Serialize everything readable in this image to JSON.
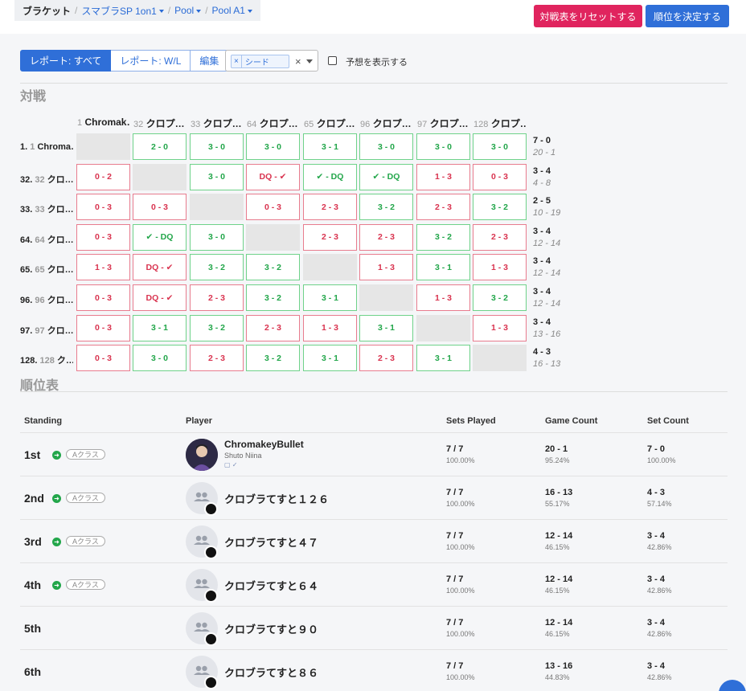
{
  "breadcrumb": {
    "home": "ブラケット",
    "items": [
      "スマブラSP 1on1",
      "Pool",
      "Pool A1"
    ]
  },
  "actions": {
    "reset": "対戦表をリセットする",
    "finalize": "順位を決定する"
  },
  "toolbar": {
    "report_all": "レポート: すべて",
    "report_wl": "レポート: W/L",
    "edit": "編集",
    "chip_remove": "×",
    "chip": "シード",
    "clear": "×",
    "show_prediction": "予想を表示する"
  },
  "matrix": {
    "title": "対戦",
    "columns": [
      {
        "seed": "1",
        "name": "Chromak…"
      },
      {
        "seed": "32",
        "name": "クロプ…"
      },
      {
        "seed": "33",
        "name": "クロプ…"
      },
      {
        "seed": "64",
        "name": "クロプ…"
      },
      {
        "seed": "65",
        "name": "クロプ…"
      },
      {
        "seed": "96",
        "name": "クロプ…"
      },
      {
        "seed": "97",
        "name": "クロプ…"
      },
      {
        "seed": "128",
        "name": "クロプ…"
      }
    ],
    "rows": [
      {
        "rank": "1.",
        "seed": "1",
        "name": "Chroma…",
        "cells": [
          [
            "self",
            ""
          ],
          [
            "win",
            "2 - 0"
          ],
          [
            "win",
            "3 - 0"
          ],
          [
            "win",
            "3 - 0"
          ],
          [
            "win",
            "3 - 1"
          ],
          [
            "win",
            "3 - 0"
          ],
          [
            "win",
            "3 - 0"
          ],
          [
            "win",
            "3 - 0"
          ]
        ],
        "sets": "7 - 0",
        "games": "20 - 1"
      },
      {
        "rank": "32.",
        "seed": "32",
        "name": "クロ…",
        "cells": [
          [
            "loss",
            "0 - 2"
          ],
          [
            "self",
            ""
          ],
          [
            "win",
            "3 - 0"
          ],
          [
            "loss",
            "DQ - ✔"
          ],
          [
            "win",
            "✔ - DQ"
          ],
          [
            "win",
            "✔ - DQ"
          ],
          [
            "loss",
            "1 - 3"
          ],
          [
            "loss",
            "0 - 3"
          ]
        ],
        "sets": "3 - 4",
        "games": "4 - 8"
      },
      {
        "rank": "33.",
        "seed": "33",
        "name": "クロ…",
        "cells": [
          [
            "loss",
            "0 - 3"
          ],
          [
            "loss",
            "0 - 3"
          ],
          [
            "self",
            ""
          ],
          [
            "loss",
            "0 - 3"
          ],
          [
            "loss",
            "2 - 3"
          ],
          [
            "win",
            "3 - 2"
          ],
          [
            "loss",
            "2 - 3"
          ],
          [
            "win",
            "3 - 2"
          ]
        ],
        "sets": "2 - 5",
        "games": "10 - 19"
      },
      {
        "rank": "64.",
        "seed": "64",
        "name": "クロ…",
        "cells": [
          [
            "loss",
            "0 - 3"
          ],
          [
            "win",
            "✔ - DQ"
          ],
          [
            "win",
            "3 - 0"
          ],
          [
            "self",
            ""
          ],
          [
            "loss",
            "2 - 3"
          ],
          [
            "loss",
            "2 - 3"
          ],
          [
            "win",
            "3 - 2"
          ],
          [
            "loss",
            "2 - 3"
          ]
        ],
        "sets": "3 - 4",
        "games": "12 - 14"
      },
      {
        "rank": "65.",
        "seed": "65",
        "name": "クロ…",
        "cells": [
          [
            "loss",
            "1 - 3"
          ],
          [
            "loss",
            "DQ - ✔"
          ],
          [
            "win",
            "3 - 2"
          ],
          [
            "win",
            "3 - 2"
          ],
          [
            "self",
            ""
          ],
          [
            "loss",
            "1 - 3"
          ],
          [
            "win",
            "3 - 1"
          ],
          [
            "loss",
            "1 - 3"
          ]
        ],
        "sets": "3 - 4",
        "games": "12 - 14"
      },
      {
        "rank": "96.",
        "seed": "96",
        "name": "クロ…",
        "cells": [
          [
            "loss",
            "0 - 3"
          ],
          [
            "loss",
            "DQ - ✔"
          ],
          [
            "loss",
            "2 - 3"
          ],
          [
            "win",
            "3 - 2"
          ],
          [
            "win",
            "3 - 1"
          ],
          [
            "self",
            ""
          ],
          [
            "loss",
            "1 - 3"
          ],
          [
            "win",
            "3 - 2"
          ]
        ],
        "sets": "3 - 4",
        "games": "12 - 14"
      },
      {
        "rank": "97.",
        "seed": "97",
        "name": "クロ…",
        "cells": [
          [
            "loss",
            "0 - 3"
          ],
          [
            "win",
            "3 - 1"
          ],
          [
            "win",
            "3 - 2"
          ],
          [
            "loss",
            "2 - 3"
          ],
          [
            "loss",
            "1 - 3"
          ],
          [
            "win",
            "3 - 1"
          ],
          [
            "self",
            ""
          ],
          [
            "loss",
            "1 - 3"
          ]
        ],
        "sets": "3 - 4",
        "games": "13 - 16"
      },
      {
        "rank": "128.",
        "seed": "128",
        "name": "ク…",
        "cells": [
          [
            "loss",
            "0 - 3"
          ],
          [
            "win",
            "3 - 0"
          ],
          [
            "loss",
            "2 - 3"
          ],
          [
            "win",
            "3 - 2"
          ],
          [
            "win",
            "3 - 1"
          ],
          [
            "loss",
            "2 - 3"
          ],
          [
            "win",
            "3 - 1"
          ],
          [
            "self",
            ""
          ]
        ],
        "sets": "4 - 3",
        "games": "16 - 13"
      }
    ]
  },
  "standings": {
    "title": "順位表",
    "headers": {
      "standing": "Standing",
      "player": "Player",
      "sets_played": "Sets Played",
      "game_count": "Game Count",
      "set_count": "Set Count"
    },
    "rows": [
      {
        "rank": "1st",
        "badge": "Aクラス",
        "name": "ChromakeyBullet",
        "sub": "Shuto Niina",
        "social": "▢ ✓",
        "sets_played": "7 / 7",
        "sets_played_pct": "100.00%",
        "games": "20 - 1",
        "games_pct": "95.24%",
        "sets": "7 - 0",
        "sets_pct": "100.00%"
      },
      {
        "rank": "2nd",
        "badge": "Aクラス",
        "name": "クロブラてすと１２６",
        "sets_played": "7 / 7",
        "sets_played_pct": "100.00%",
        "games": "16 - 13",
        "games_pct": "55.17%",
        "sets": "4 - 3",
        "sets_pct": "57.14%"
      },
      {
        "rank": "3rd",
        "badge": "Aクラス",
        "name": "クロブラてすと４７",
        "sets_played": "7 / 7",
        "sets_played_pct": "100.00%",
        "games": "12 - 14",
        "games_pct": "46.15%",
        "sets": "3 - 4",
        "sets_pct": "42.86%"
      },
      {
        "rank": "4th",
        "badge": "Aクラス",
        "name": "クロブラてすと６４",
        "sets_played": "7 / 7",
        "sets_played_pct": "100.00%",
        "games": "12 - 14",
        "games_pct": "46.15%",
        "sets": "3 - 4",
        "sets_pct": "42.86%"
      },
      {
        "rank": "5th",
        "name": "クロブラてすと９０",
        "sets_played": "7 / 7",
        "sets_played_pct": "100.00%",
        "games": "12 - 14",
        "games_pct": "46.15%",
        "sets": "3 - 4",
        "sets_pct": "42.86%"
      },
      {
        "rank": "6th",
        "name": "クロブラてすと８６",
        "sets_played": "7 / 7",
        "sets_played_pct": "100.00%",
        "games": "13 - 16",
        "games_pct": "44.83%",
        "sets": "3 - 4",
        "sets_pct": "42.86%"
      }
    ]
  }
}
